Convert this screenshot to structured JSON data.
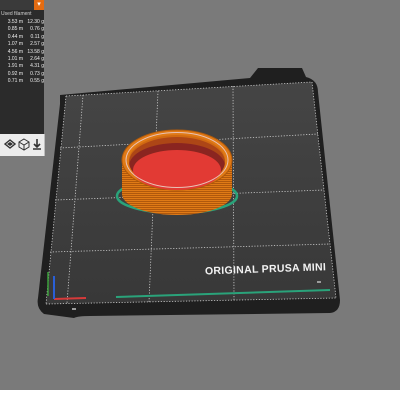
{
  "legend": {
    "header": "Used filament",
    "rows": [
      {
        "length": "3.53 m",
        "weight": "12.30 g"
      },
      {
        "length": "0.85 m",
        "weight": "0.76 g"
      },
      {
        "length": "0.44 m",
        "weight": "0.11 g"
      },
      {
        "length": "1.07 m",
        "weight": "2.57 g"
      },
      {
        "length": "4.56 m",
        "weight": "13.58 g"
      },
      {
        "length": "1.01 m",
        "weight": "2.64 g"
      },
      {
        "length": "1.91 m",
        "weight": "4.31 g"
      },
      {
        "length": "0.92 m",
        "weight": "0.73 g"
      },
      {
        "length": "0.71 m",
        "weight": "0.55 g"
      }
    ]
  },
  "view_toolbar": {
    "icons": [
      "layers-icon",
      "cube-icon",
      "export-gcode-icon"
    ]
  },
  "bed": {
    "label": "ORIGINAL PRUSA MINI"
  },
  "colors": {
    "viewport_background": "#7a7a7a",
    "bed_surface": "#3d3d3d",
    "bed_grid": "#cfcfcf",
    "print_wall": "#e07a16",
    "print_top_layer": "#e23a34",
    "skirt_line": "#2aa37a",
    "accent": "#e46c12"
  }
}
